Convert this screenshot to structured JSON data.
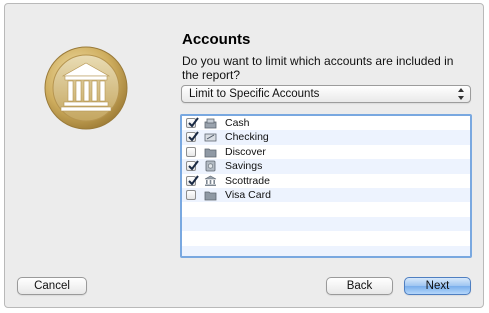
{
  "page": {
    "title": "Accounts",
    "question": "Do you want to limit which accounts are included in the report?"
  },
  "account_filter": {
    "selected": "Limit to Specific Accounts"
  },
  "accounts": [
    {
      "label": "Cash",
      "checked": true,
      "icon": "cash-icon"
    },
    {
      "label": "Checking",
      "checked": true,
      "icon": "checkbook-icon"
    },
    {
      "label": "Discover",
      "checked": false,
      "icon": "folder-icon"
    },
    {
      "label": "Savings",
      "checked": true,
      "icon": "piggybank-icon"
    },
    {
      "label": "Scottrade",
      "checked": true,
      "icon": "bank-icon"
    },
    {
      "label": "Visa Card",
      "checked": false,
      "icon": "folder-icon"
    }
  ],
  "buttons": {
    "cancel": "Cancel",
    "back": "Back",
    "next": "Next"
  },
  "colors": {
    "accent": "#79a8e0",
    "row_stripe": "#edf3fe",
    "logo_gold": "#c9a95c"
  }
}
